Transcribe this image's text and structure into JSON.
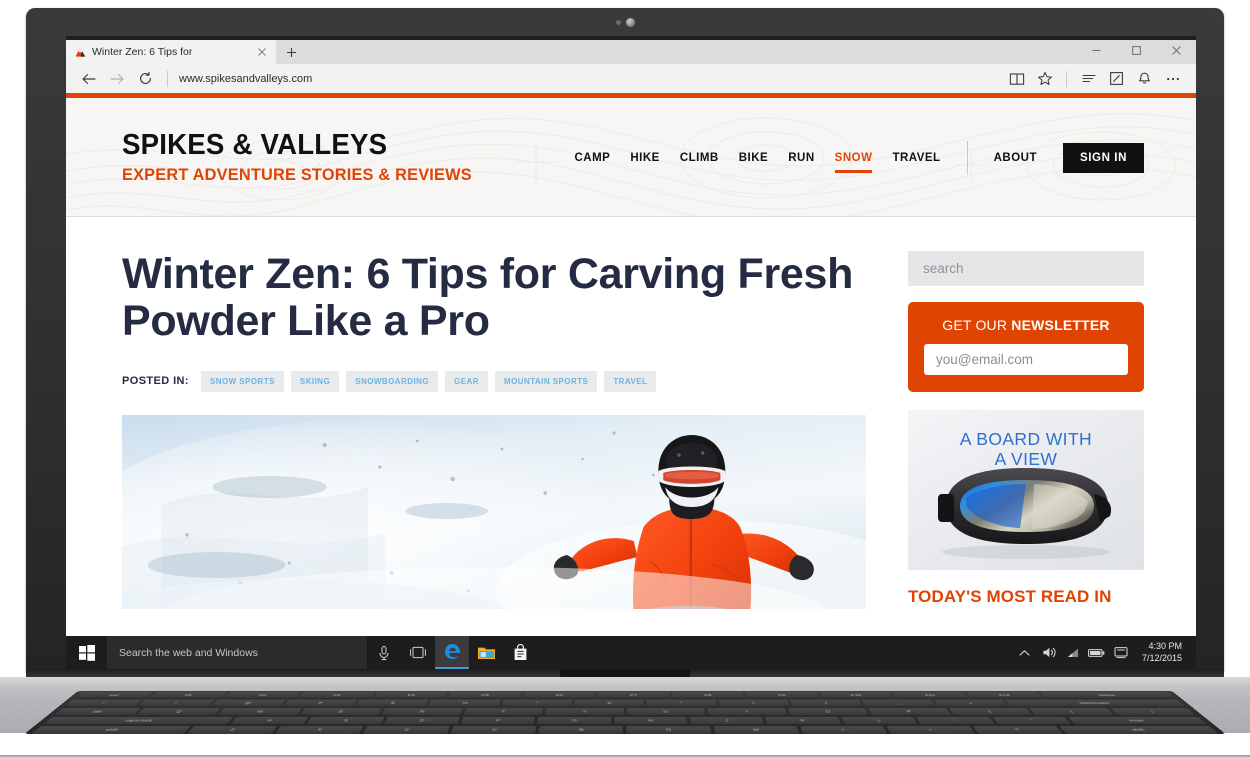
{
  "browser": {
    "tab": {
      "title": "Winter Zen: 6 Tips for",
      "favicon_icon": "mountain-icon",
      "close_icon": "close-icon"
    },
    "new_tab_label": "+",
    "window_controls": {
      "minimize": "–",
      "maximize": "□",
      "close": "✕"
    },
    "nav": {
      "back_icon": "back-arrow-icon",
      "forward_icon": "forward-arrow-icon",
      "refresh_icon": "refresh-icon",
      "url": "www.spikesandvalleys.com"
    },
    "toolbar_icons": [
      "reading-view-icon",
      "favorites-star-icon",
      "reading-list-icon",
      "web-note-icon",
      "share-icon",
      "more-icon"
    ],
    "accent_color": "#e04403"
  },
  "site": {
    "brand_name": "SPIKES & VALLEYS",
    "brand_tagline": "EXPERT ADVENTURE STORIES & REVIEWS",
    "nav_items": [
      {
        "label": "CAMP",
        "active": false
      },
      {
        "label": "HIKE",
        "active": false
      },
      {
        "label": "CLIMB",
        "active": false
      },
      {
        "label": "BIKE",
        "active": false
      },
      {
        "label": "RUN",
        "active": false
      },
      {
        "label": "SNOW",
        "active": true
      },
      {
        "label": "TRAVEL",
        "active": false
      }
    ],
    "about_label": "ABOUT",
    "signin_label": "SIGN IN"
  },
  "article": {
    "headline": "Winter Zen: 6 Tips for Carving Fresh Powder Like a Pro",
    "posted_in_label": "POSTED IN:",
    "tags": [
      "SNOW SPORTS",
      "SKIING",
      "SNOWBOARDING",
      "GEAR",
      "MOUNTAIN SPORTS",
      "TRAVEL"
    ],
    "hero_alt": "snowboarder-in-orange-jacket-powder-snow"
  },
  "sidebar": {
    "search_placeholder": "search",
    "newsletter": {
      "title_prefix": "GET OUR ",
      "title_strong": "NEWSLETTER",
      "email_placeholder": "you@email.com",
      "background_color": "#e04403"
    },
    "ad": {
      "line1": "A BOARD WITH",
      "line2": "A VIEW",
      "text_color": "#2f6fd0",
      "image_alt": "ski-goggles-product"
    },
    "most_read_heading": "TODAY'S MOST READ IN"
  },
  "taskbar": {
    "start_icon": "windows-start-icon",
    "search_placeholder": "Search the web and Windows",
    "cortana_icon": "microphone-icon",
    "taskview_icon": "task-view-icon",
    "apps": [
      {
        "name": "edge-icon",
        "active": true
      },
      {
        "name": "file-explorer-icon",
        "active": false
      },
      {
        "name": "store-icon",
        "active": false
      }
    ],
    "tray_icons": [
      "chevron-up-icon",
      "speaker-icon",
      "wifi-icon",
      "battery-icon",
      "action-center-icon"
    ],
    "time": "4:30 PM",
    "date": "7/12/2015"
  },
  "keyboard": {
    "fn_row": [
      "esc",
      "F1",
      "F2",
      "F3",
      "F4",
      "F5",
      "F6",
      "F7",
      "F8",
      "F9",
      "F10",
      "F11",
      "F12",
      "delete"
    ],
    "num_row": [
      "~",
      "!",
      "@",
      "#",
      "$",
      "%",
      "^",
      "&",
      "*",
      "(",
      ")",
      "_",
      "+",
      "backspace"
    ],
    "top_row": [
      "tab",
      "Q",
      "W",
      "E",
      "R",
      "T",
      "Y",
      "U",
      "I",
      "O",
      "P",
      "{",
      "}",
      "|"
    ],
    "home_row": [
      "caps lock",
      "A",
      "S",
      "D",
      "F",
      "G",
      "H",
      "J",
      "K",
      "L",
      ":",
      "\"",
      "enter"
    ],
    "bottom_row": [
      "shift",
      "Z",
      "X",
      "C",
      "V",
      "B",
      "N",
      "M",
      "<",
      ">",
      "?",
      "shift"
    ]
  }
}
